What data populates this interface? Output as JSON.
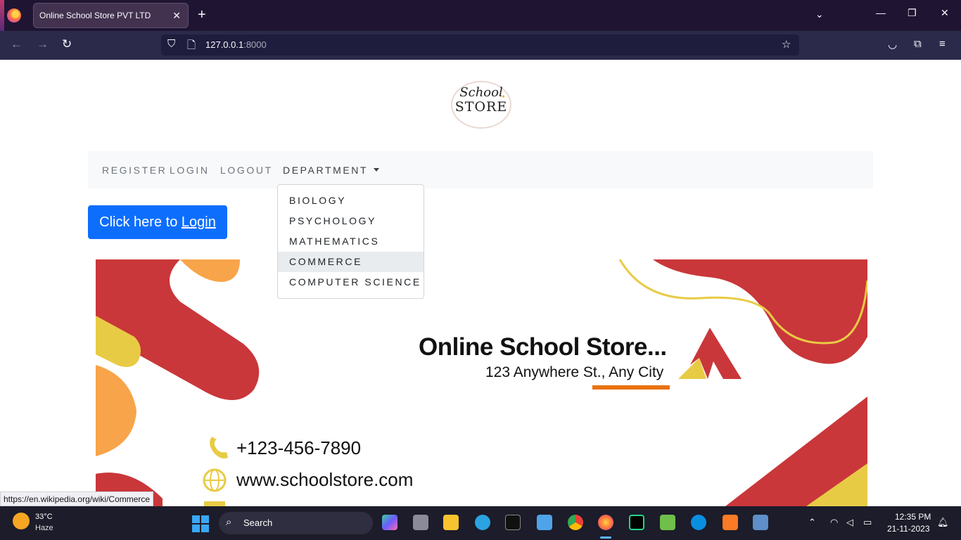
{
  "browser": {
    "tab_title": "Online School Store PVT LTD",
    "tab_close": "✕",
    "new_tab": "+",
    "url_host": "127.0.0.1",
    "url_port": ":8000"
  },
  "site": {
    "logo_script": "School",
    "logo_main": "STORE",
    "nav": {
      "register": "REGISTER",
      "login": "LOGIN",
      "logout": "LOGOUT",
      "department": "DEPARTMENT"
    },
    "department_menu": [
      "BIOLOGY",
      "PSYCHOLOGY",
      "MATHEMATICS",
      "COMMERCE",
      "COMPUTER SCIENCE"
    ],
    "hovered_item": "COMMERCE",
    "login_button_prefix": "Click here to ",
    "login_button_link": "Login"
  },
  "banner": {
    "title": "Online School Store...",
    "address": "123 Anywhere St., Any City",
    "phone": "+123-456-7890",
    "website": "www.schoolstore.com",
    "colors": {
      "red": "#c9373a",
      "yellow": "#e8cb45",
      "orange": "#f8a44a",
      "accent": "#e9720f"
    }
  },
  "status_bar": {
    "hover_url": "https://en.wikipedia.org/wiki/Commerce"
  },
  "taskbar": {
    "weather_temp": "33°C",
    "weather_condition": "Haze",
    "search_placeholder": "Search",
    "time": "12:35 PM",
    "date": "21-11-2023",
    "apps": [
      "copilot-icon",
      "task-view-icon",
      "file-explorer-icon",
      "telegram-icon",
      "terminal-icon",
      "notepad-icon",
      "chrome-icon",
      "firefox-icon",
      "pycharm-icon",
      "notepad-plus-icon",
      "skype-icon",
      "xampp-icon",
      "monitor-icon"
    ]
  }
}
